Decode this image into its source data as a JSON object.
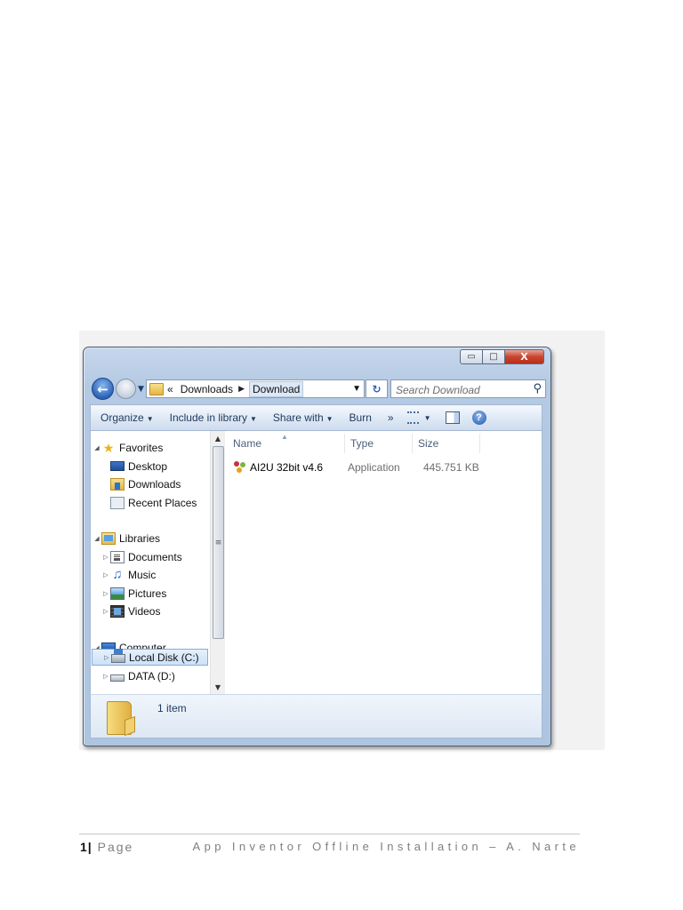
{
  "explorer": {
    "window_controls": {
      "minimize": "▭",
      "maximize": "□",
      "close": "X"
    },
    "address": {
      "overflow": "«",
      "crumbs": [
        "Downloads",
        "Download"
      ],
      "search_placeholder": "Search Download"
    },
    "toolbar": {
      "organize": "Organize",
      "include_in_library": "Include in library",
      "share_with": "Share with",
      "burn": "Burn",
      "more": "»"
    },
    "nav_pane": {
      "favorites": "Favorites",
      "desktop": "Desktop",
      "downloads": "Downloads",
      "recent_places": "Recent Places",
      "libraries": "Libraries",
      "documents": "Documents",
      "music": "Music",
      "pictures": "Pictures",
      "videos": "Videos",
      "computer": "Computer",
      "local_disk": "Local Disk (C:)",
      "data_drive": "DATA (D:)"
    },
    "columns": {
      "name": "Name",
      "type": "Type",
      "size": "Size"
    },
    "files": [
      {
        "name": "AI2U 32bit v4.6",
        "type": "Application",
        "size": "445.751 KB"
      }
    ],
    "details": {
      "count": "1 item"
    }
  },
  "footer": {
    "page_number": "1",
    "separator": "|",
    "page_label": "Page",
    "title": "App Inventor Offline Installation – A. Narte"
  }
}
